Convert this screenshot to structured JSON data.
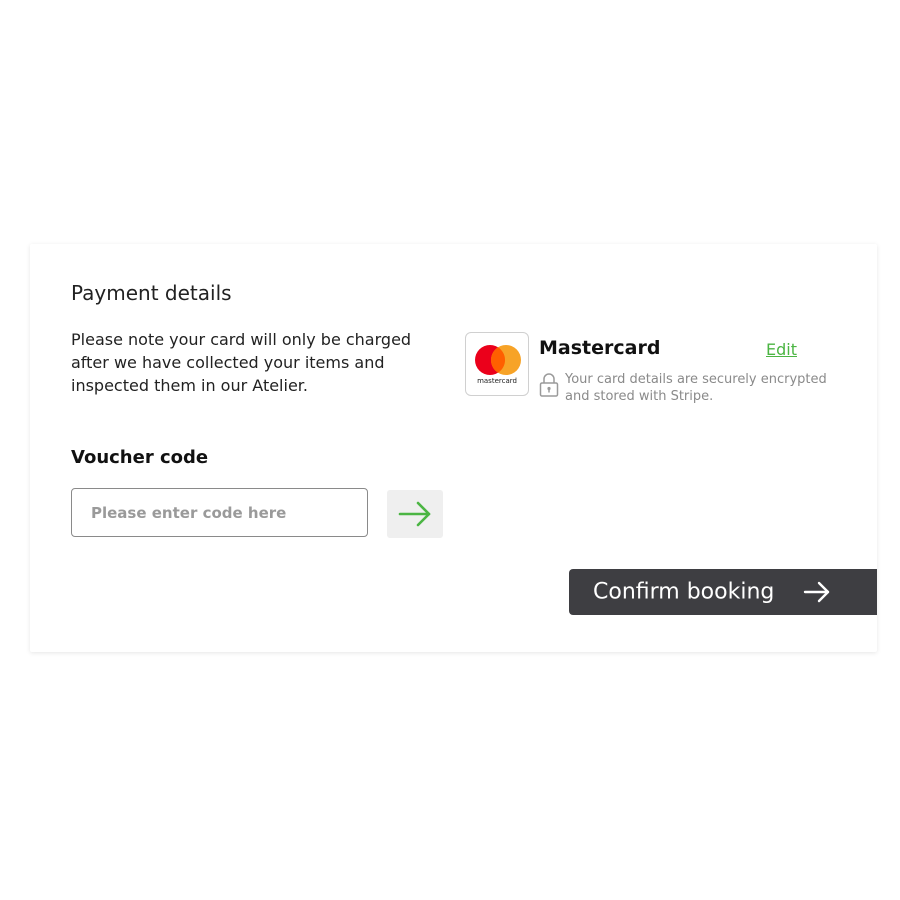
{
  "payment": {
    "title": "Payment details",
    "note": "Please note your card will only be charged after we have collected your items and inspected them in our Atelier.",
    "card": {
      "brand_logo_text": "mastercard",
      "name": "Mastercard",
      "edit_label": "Edit",
      "security_text": "Your card details are securely encrypted and stored with Stripe."
    }
  },
  "voucher": {
    "label": "Voucher code",
    "placeholder": "Please enter code here",
    "value": ""
  },
  "actions": {
    "confirm_label": "Confirm booking"
  },
  "icons": {
    "voucher_submit": "arrow-right-icon",
    "confirm": "arrow-right-icon",
    "lock": "lock-icon",
    "brand": "mastercard-logo-icon"
  },
  "colors": {
    "accent_green": "#4bb543",
    "mastercard_red": "#eb001b",
    "mastercard_orange": "#f79e1b",
    "button_dark": "#3e3e42",
    "muted_text": "#8a8a8a"
  }
}
